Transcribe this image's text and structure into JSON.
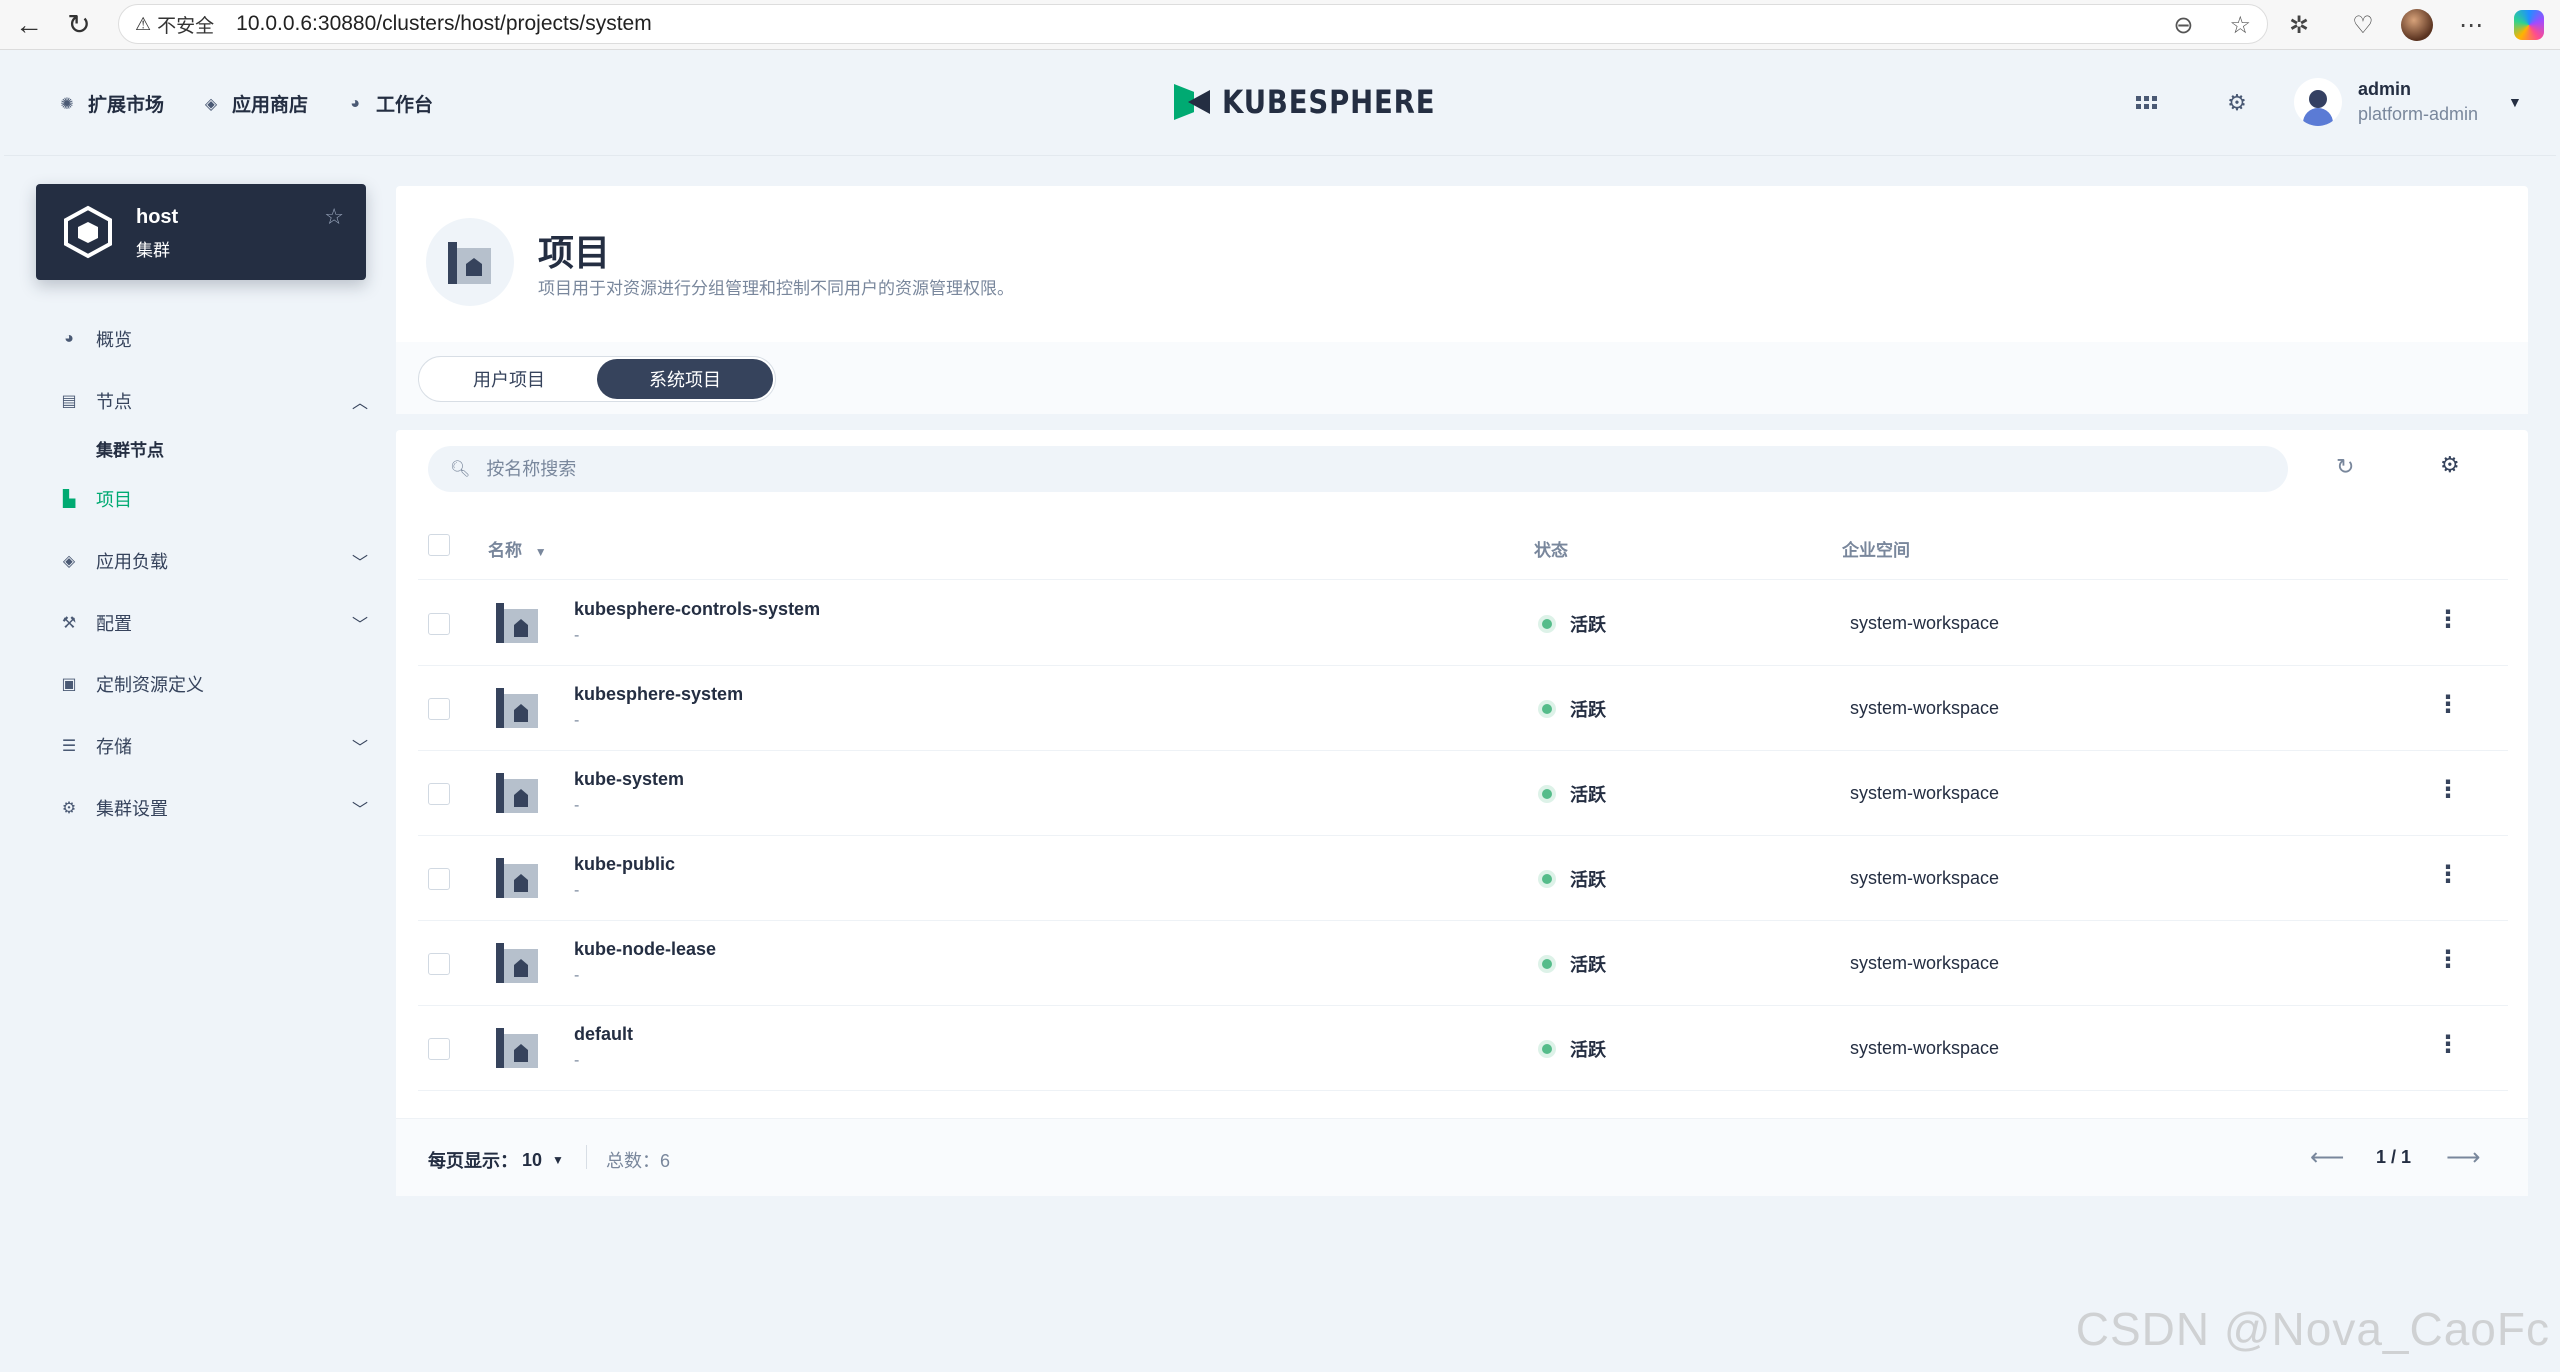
{
  "browser": {
    "security_label": "不安全",
    "url": "10.0.0.6:30880/clusters/host/projects/system"
  },
  "topnav": {
    "items": [
      {
        "label": "扩展市场",
        "icon": "extension-icon"
      },
      {
        "label": "应用商店",
        "icon": "layers-icon"
      },
      {
        "label": "工作台",
        "icon": "workbench-icon"
      }
    ],
    "logo_text": "KUBESPHERE",
    "user_name": "admin",
    "user_role": "platform-admin"
  },
  "cluster": {
    "name": "host",
    "type": "集群"
  },
  "sidebar": {
    "items": [
      {
        "label": "概览"
      },
      {
        "label": "节点"
      },
      {
        "label": "集群节点"
      },
      {
        "label": "项目"
      },
      {
        "label": "应用负载"
      },
      {
        "label": "配置"
      },
      {
        "label": "定制资源定义"
      },
      {
        "label": "存储"
      },
      {
        "label": "集群设置"
      }
    ]
  },
  "header": {
    "title": "项目",
    "description": "项目用于对资源进行分组管理和控制不同用户的资源管理权限。"
  },
  "tabs": [
    {
      "label": "用户项目"
    },
    {
      "label": "系统项目"
    }
  ],
  "search": {
    "placeholder": "按名称搜索"
  },
  "table": {
    "columns": {
      "name": "名称",
      "status": "状态",
      "workspace": "企业空间"
    },
    "rows": [
      {
        "name": "kubesphere-controls-system",
        "desc": "-",
        "status": "活跃",
        "workspace": "system-workspace"
      },
      {
        "name": "kubesphere-system",
        "desc": "-",
        "status": "活跃",
        "workspace": "system-workspace"
      },
      {
        "name": "kube-system",
        "desc": "-",
        "status": "活跃",
        "workspace": "system-workspace"
      },
      {
        "name": "kube-public",
        "desc": "-",
        "status": "活跃",
        "workspace": "system-workspace"
      },
      {
        "name": "kube-node-lease",
        "desc": "-",
        "status": "活跃",
        "workspace": "system-workspace"
      },
      {
        "name": "default",
        "desc": "-",
        "status": "活跃",
        "workspace": "system-workspace"
      }
    ]
  },
  "pagination": {
    "per_page_label": "每页显示：",
    "per_page_value": "10",
    "total_label": "总数：",
    "total_value": "6",
    "page": "1 / 1"
  },
  "colors": {
    "accent": "#00aa72",
    "dark": "#242e42",
    "status_active": "#55bc8a"
  },
  "watermark": "CSDN @Nova_CaoFc"
}
